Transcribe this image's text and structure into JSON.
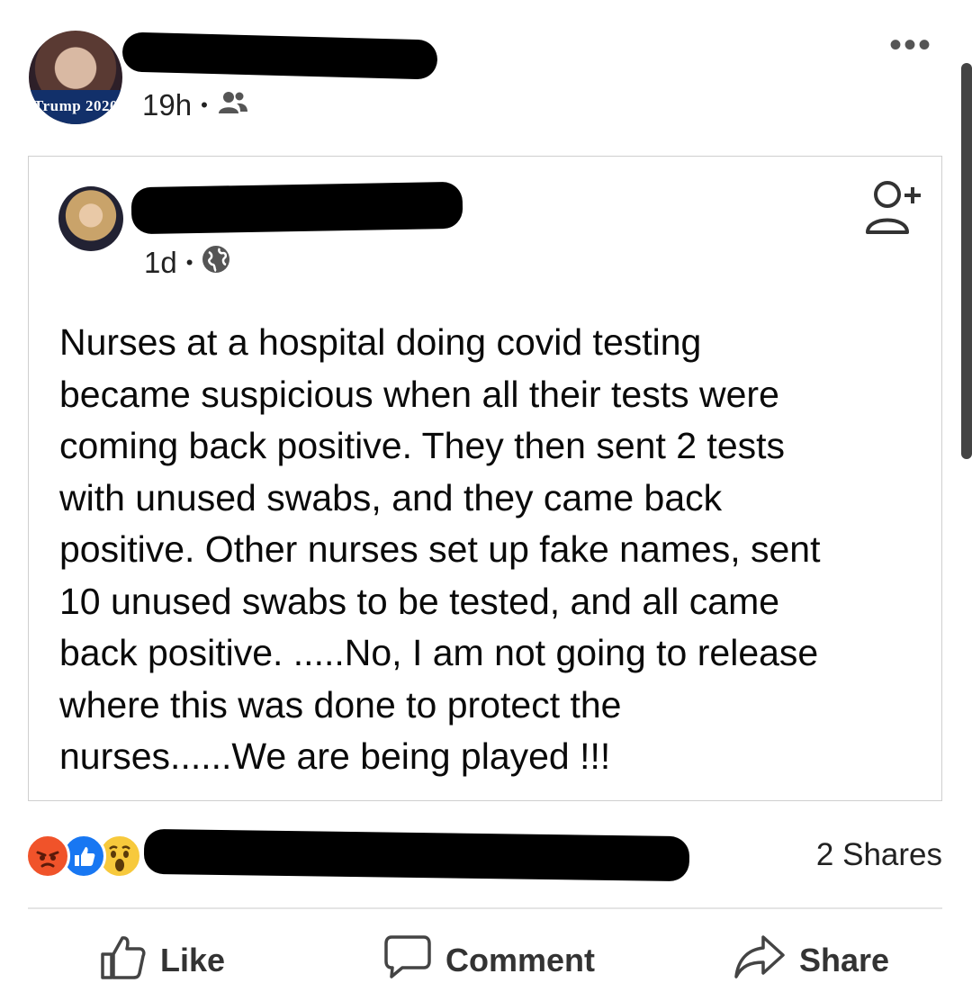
{
  "outer_post": {
    "avatar_badge_text": "Trump 2020",
    "timestamp": "19h",
    "separator": "•",
    "audience_icon": "friends-icon",
    "more_icon": "more-options-icon",
    "more_label": "•••"
  },
  "shared_post": {
    "timestamp": "1d",
    "separator": "•",
    "audience_icon": "globe-icon",
    "add_friend_icon": "add-friend-icon",
    "text": "Nurses at a hospital doing covid testing\nbecame suspicious when all their tests were\ncoming back positive. They then sent 2 tests\nwith unused swabs, and they came back\npositive. Other nurses set up fake names, sent\n10 unused swabs to be tested, and all came\nback positive. .....No, I am not going to release\nwhere this was done to protect the\nnurses......We are being played !!!"
  },
  "reactions": {
    "icons": [
      "angry-reaction-icon",
      "like-reaction-icon",
      "wow-reaction-icon"
    ],
    "shares_label": "2 Shares"
  },
  "actions": {
    "like_label": "Like",
    "comment_label": "Comment",
    "share_label": "Share"
  },
  "colors": {
    "like_blue": "#1877F2",
    "angry_orange": "#F0532A",
    "wow_yellow": "#F7C93C",
    "redaction": "#000000"
  }
}
